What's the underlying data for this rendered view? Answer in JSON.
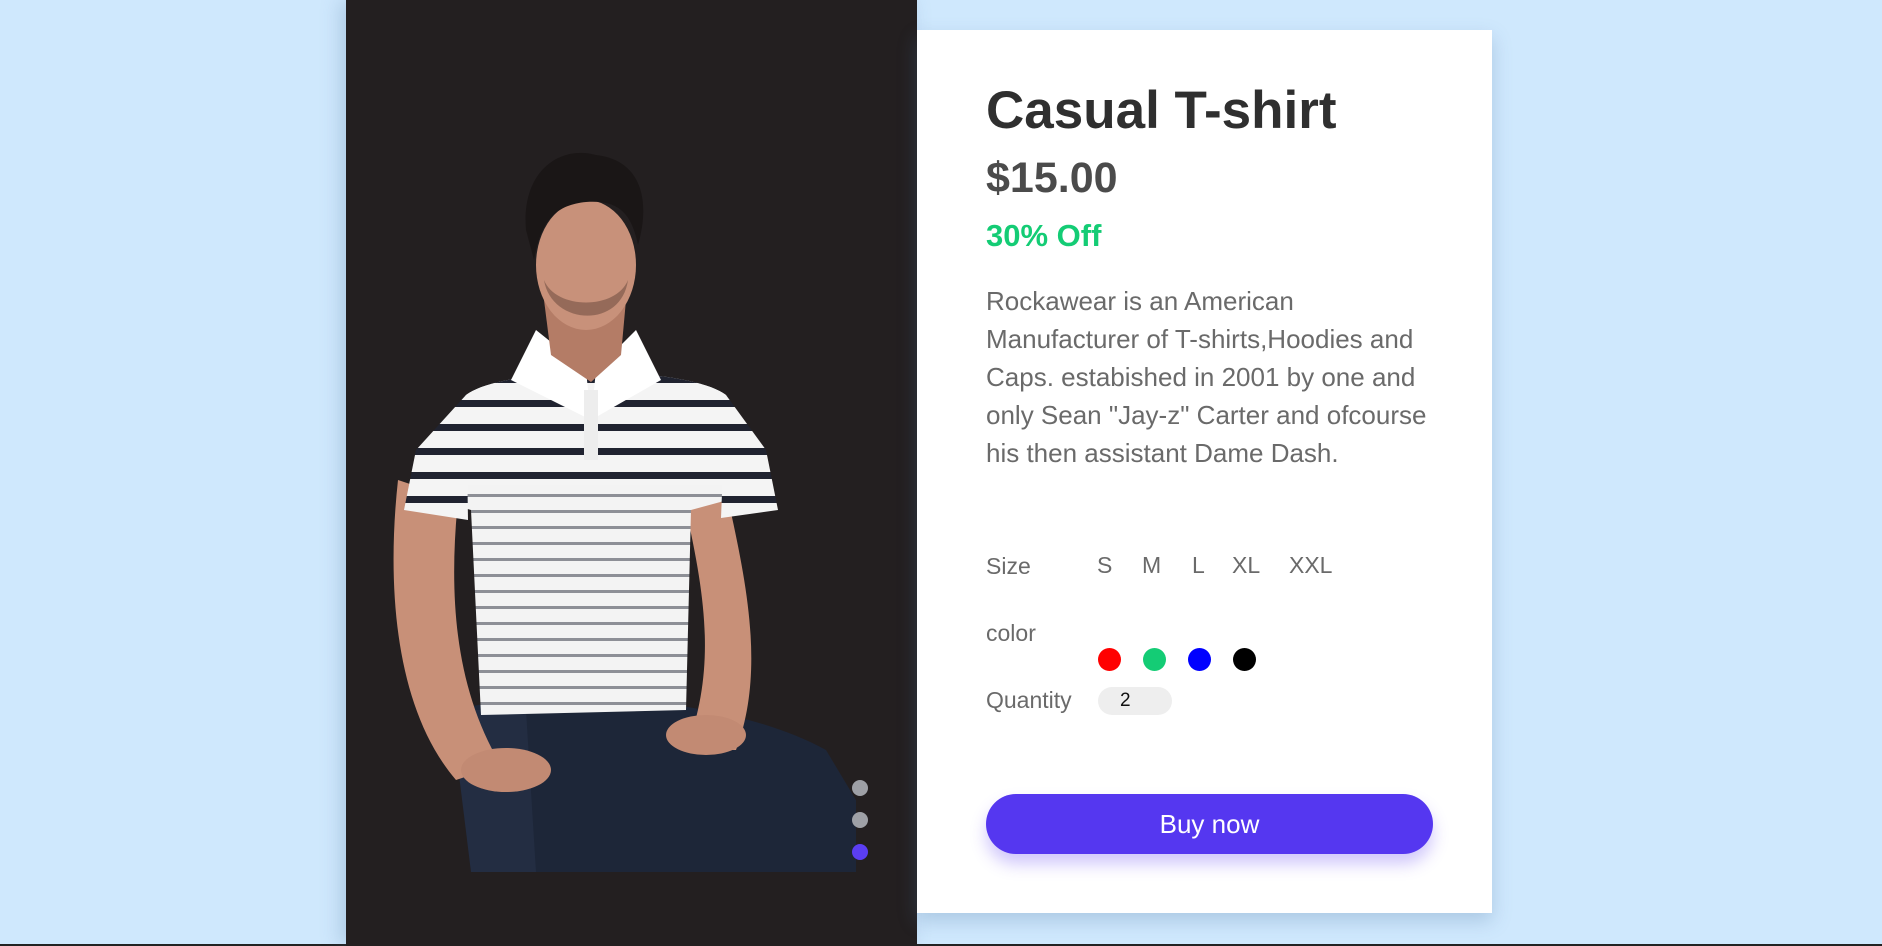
{
  "product": {
    "title": "Casual T-shirt",
    "price": "$15.00",
    "discount": "30% Off",
    "description": "Rockawear is an American Manufacturer of T-shirts,Hoodies and Caps. estabished in 2001 by one and only Sean \"Jay-z\" Carter and ofcourse his then assistant Dame Dash."
  },
  "options": {
    "size_label": "Size",
    "sizes": [
      "S",
      "M",
      "L",
      "XL",
      "XXL"
    ],
    "color_label": "color",
    "colors": [
      "#ff0000",
      "#14cc75",
      "#0000ff",
      "#000000"
    ],
    "quantity_label": "Quantity",
    "quantity_value": "2"
  },
  "actions": {
    "buy_label": "Buy now"
  },
  "gallery": {
    "slide_count": 3,
    "active_slide": 3
  },
  "theme": {
    "background": "#cfe8fd",
    "image_panel_bg": "#231f20",
    "accent": "#5537f0",
    "discount_color": "#14cc75"
  }
}
